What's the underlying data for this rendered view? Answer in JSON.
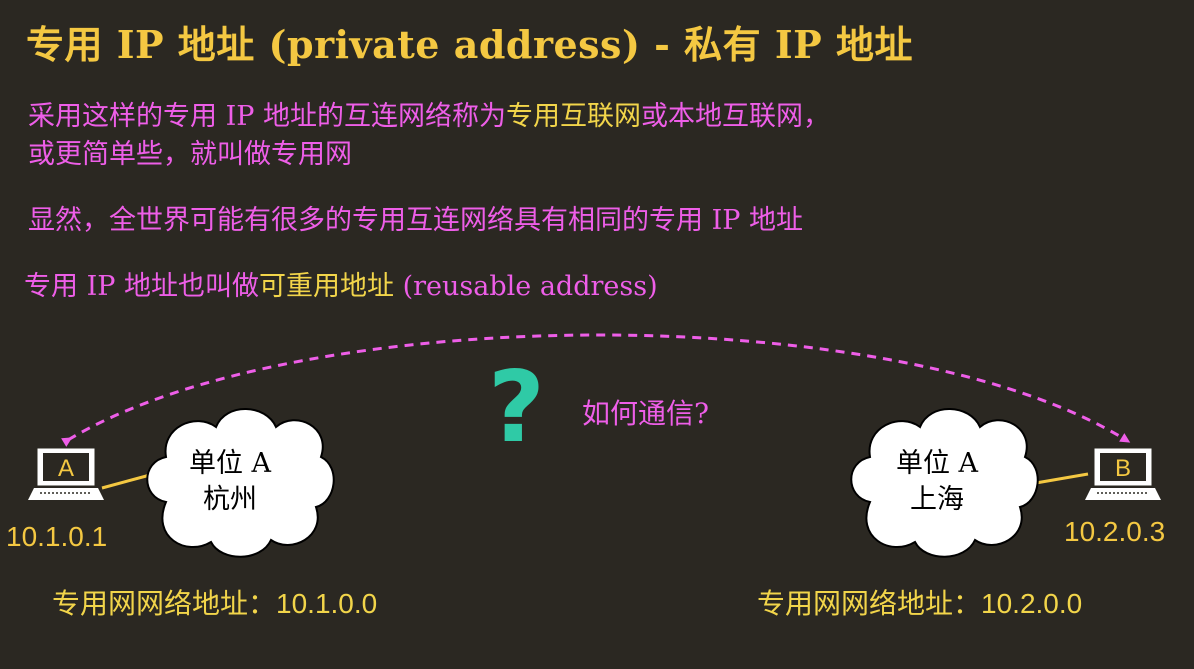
{
  "title": "专用 IP 地址 (private address) - 私有 IP 地址",
  "paragraphs": {
    "p1_line1_a": "采用这样的专用 IP 地址的互连网络称为",
    "p1_line1_b": "专用互联网",
    "p1_line1_c": "或",
    "p1_line1_d": "本地互联网",
    "p1_line1_e": "，",
    "p1_line2_a": "或更简单些，就叫做",
    "p1_line2_b": "专用网",
    "p2": "显然，全世界可能有很多的专用互连网络具有相同的专用 IP 地址",
    "p3_a": "专用 IP 地址也叫做",
    "p3_b": "可重用地址",
    "p3_c": " (reusable address)"
  },
  "diagram": {
    "question_mark": "?",
    "question_label": "如何通信?",
    "host_a": {
      "letter": "A",
      "ip": "10.1.0.1"
    },
    "host_b": {
      "letter": "B",
      "ip": "10.2.0.3"
    },
    "cloud_a": {
      "line1": "单位 A",
      "line2": "杭州"
    },
    "cloud_b": {
      "line1": "单位 A",
      "line2": "上海"
    },
    "network_a": {
      "label": "专用网网络地址：",
      "addr": "10.1.0.0"
    },
    "network_b": {
      "label": "专用网网络地址：",
      "addr": "10.2.0.0"
    }
  },
  "colors": {
    "background": "#2b2822",
    "title": "#f4c842",
    "pink": "#ee5ee8",
    "yellow": "#f2d54a",
    "teal": "#2fcaa6"
  }
}
